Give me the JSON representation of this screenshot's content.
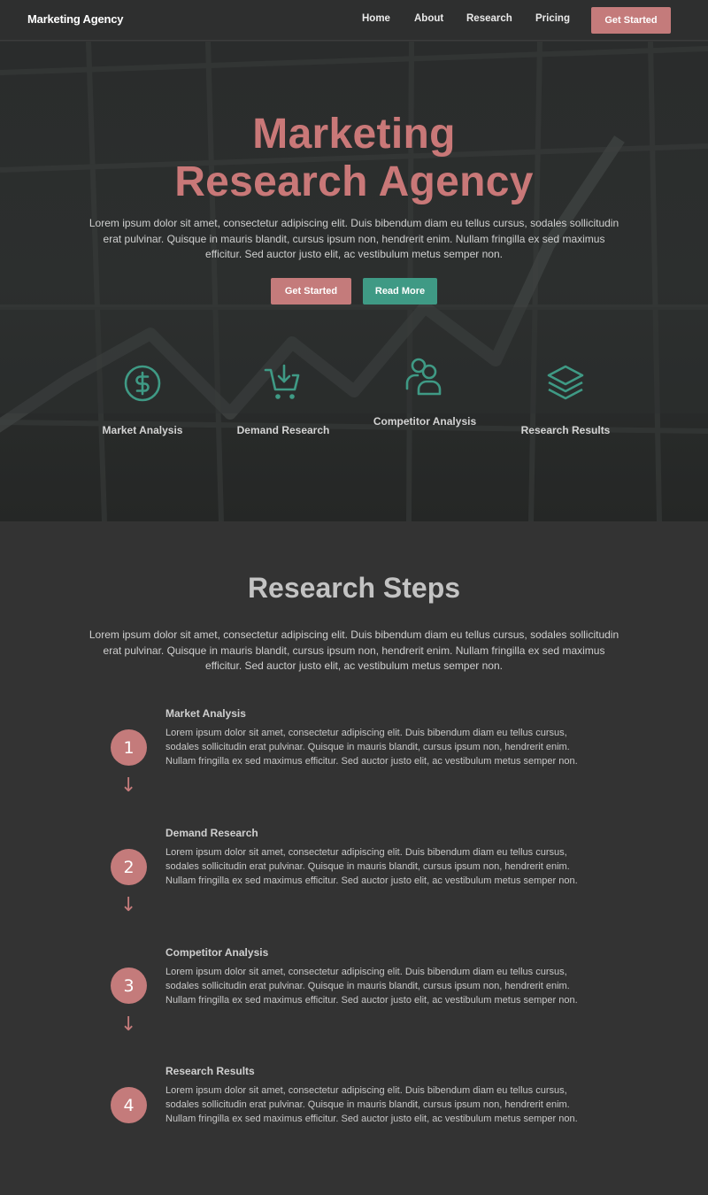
{
  "nav": {
    "brand": "Marketing Agency",
    "links": [
      "Home",
      "About",
      "Research",
      "Pricing"
    ],
    "cta": "Get Started"
  },
  "hero": {
    "title_line1": "Marketing",
    "title_line2": "Research Agency",
    "text": "Lorem ipsum dolor sit amet, consectetur adipiscing elit. Duis bibendum diam eu tellus cursus, sodales sollicitudin erat pulvinar. Quisque in mauris blandit, cursus ipsum non, hendrerit enim. Nullam fringilla ex sed maximus efficitur. Sed auctor justo elit, ac vestibulum metus semper non.",
    "primary_button": "Get Started",
    "secondary_button": "Read More",
    "features": [
      {
        "icon": "dollar-circle-icon",
        "label": "Market Analysis"
      },
      {
        "icon": "cart-download-icon",
        "label": "Demand Research"
      },
      {
        "icon": "users-icon",
        "label": "Competitor Analysis"
      },
      {
        "icon": "layers-icon",
        "label": "Research Results"
      }
    ]
  },
  "steps": {
    "title": "Research Steps",
    "text": "Lorem ipsum dolor sit amet, consectetur adipiscing elit. Duis bibendum diam eu tellus cursus, sodales sollicitudin erat pulvinar. Quisque in mauris blandit, cursus ipsum non, hendrerit enim. Nullam fringilla ex sed maximus efficitur. Sed auctor justo elit, ac vestibulum metus semper non.",
    "items": [
      {
        "number": "1",
        "title": "Market Analysis",
        "text": "Lorem ipsum dolor sit amet, consectetur adipiscing elit. Duis bibendum diam eu tellus cursus, sodales sollicitudin erat pulvinar. Quisque in mauris blandit, cursus ipsum non, hendrerit enim. Nullam fringilla ex sed maximus efficitur. Sed auctor justo elit, ac vestibulum metus semper non."
      },
      {
        "number": "2",
        "title": "Demand Research",
        "text": "Lorem ipsum dolor sit amet, consectetur adipiscing elit. Duis bibendum diam eu tellus cursus, sodales sollicitudin erat pulvinar. Quisque in mauris blandit, cursus ipsum non, hendrerit enim. Nullam fringilla ex sed maximus efficitur. Sed auctor justo elit, ac vestibulum metus semper non."
      },
      {
        "number": "3",
        "title": "Competitor Analysis",
        "text": "Lorem ipsum dolor sit amet, consectetur adipiscing elit. Duis bibendum diam eu tellus cursus, sodales sollicitudin erat pulvinar. Quisque in mauris blandit, cursus ipsum non, hendrerit enim. Nullam fringilla ex sed maximus efficitur. Sed auctor justo elit, ac vestibulum metus semper non."
      },
      {
        "number": "4",
        "title": "Research Results",
        "text": "Lorem ipsum dolor sit amet, consectetur adipiscing elit. Duis bibendum diam eu tellus cursus, sodales sollicitudin erat pulvinar. Quisque in mauris blandit, cursus ipsum non, hendrerit enim. Nullam fringilla ex sed maximus efficitur. Sed auctor justo elit, ac vestibulum metus semper non."
      }
    ],
    "arrow_icon": "arrow-down-icon"
  },
  "colors": {
    "accent": "#c47b7b",
    "secondary": "#3f9a85",
    "background": "#333333",
    "nav_background": "#2e2f2f"
  }
}
